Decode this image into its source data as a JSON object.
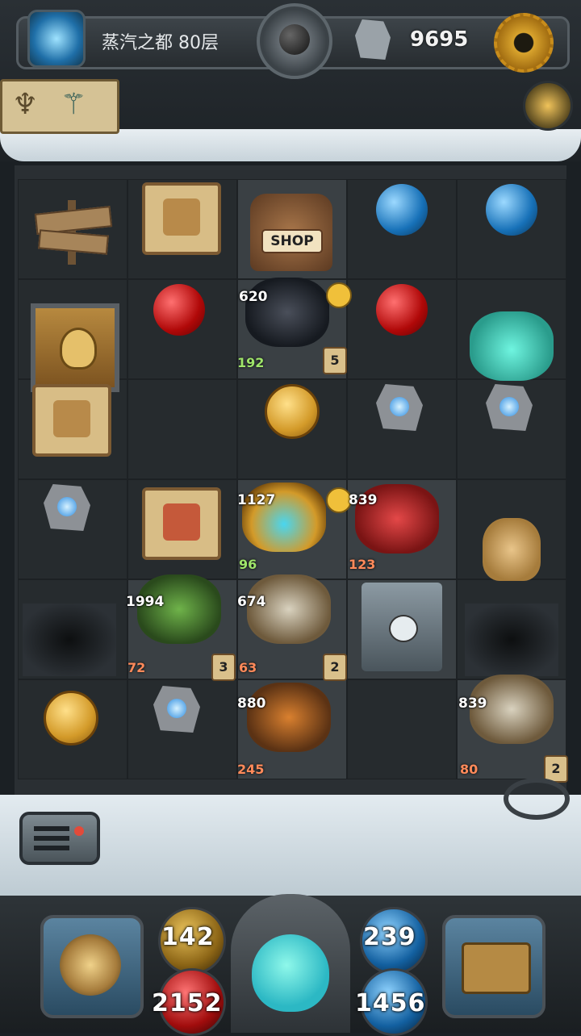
{
  "header": {
    "floor_title": "蒸汽之都 80层",
    "gem_count": "9695"
  },
  "board_text": {
    "shop_label": "SHOP",
    "spider_atk": "620",
    "spider_def": "192",
    "spider_lvl": "5",
    "knight_atk": "1127",
    "knight_def": "96",
    "robot_red_atk": "839",
    "robot_red_def": "123",
    "green_mech_atk": "1994",
    "green_mech_def": "72",
    "green_mech_lvl": "3",
    "tank_atk": "674",
    "tank_def": "63",
    "tank_lvl": "2",
    "crab_atk": "880",
    "crab_def": "245",
    "tank2_atk": "839",
    "tank2_def": "80",
    "tank2_lvl": "2"
  },
  "hud": {
    "attack": "142",
    "hp": "2152",
    "defense": "239",
    "mana": "1456"
  },
  "colors": {
    "hp_red": "#b00808",
    "mana_blue": "#1771b8",
    "coin_gold": "#d39a29",
    "snow": "#e3ebf0"
  }
}
